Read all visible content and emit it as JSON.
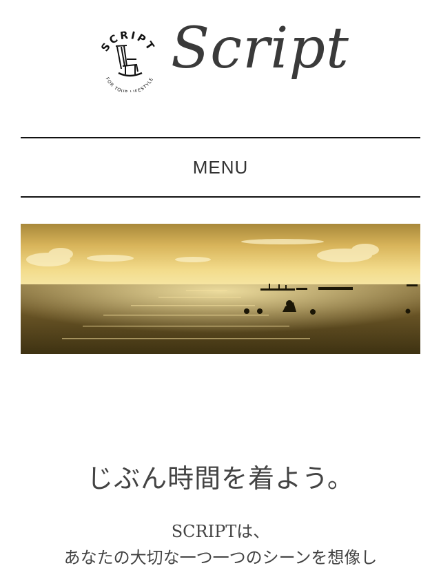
{
  "header": {
    "emblem_top_text": "SCRIPT",
    "emblem_bottom_text": "FOR YOUR LIFESTYLE",
    "wordmark": "Script"
  },
  "nav": {
    "menu_label": "MENU"
  },
  "hero": {
    "image_desc": "sunset-sea-with-paddleboarders"
  },
  "content": {
    "tagline": "じぶん時間を着よう。",
    "intro_line1": "SCRIPTは、",
    "intro_line2": "あなたの大切な一つ一つのシーンを想像し"
  },
  "colors": {
    "text": "#333333",
    "rule": "#111111",
    "sky_top": "#b79a42",
    "sky_glow": "#f0d27a",
    "sea": "#6e5a2a"
  }
}
